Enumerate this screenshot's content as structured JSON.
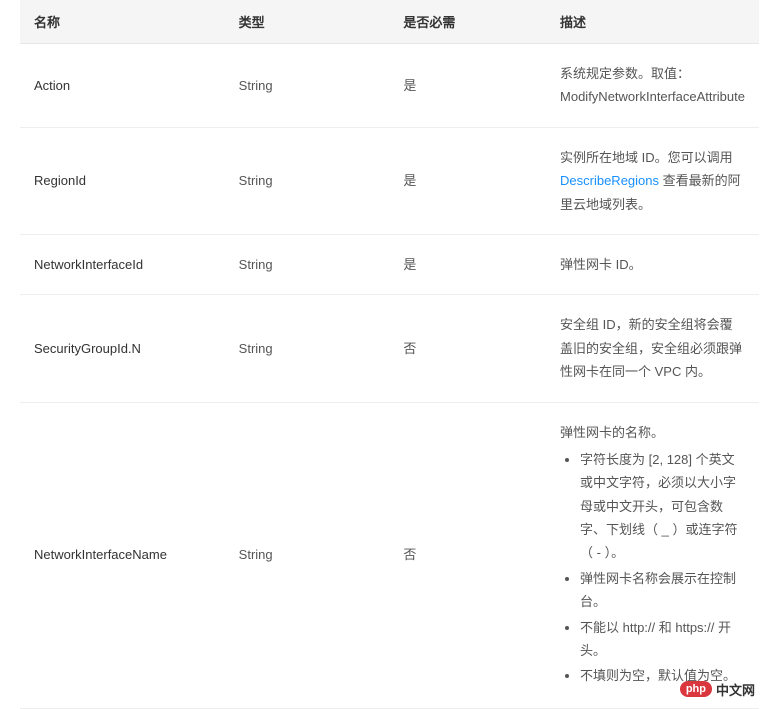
{
  "table": {
    "headers": {
      "name": "名称",
      "type": "类型",
      "required": "是否必需",
      "description": "描述"
    },
    "rows": [
      {
        "name": "Action",
        "type": "String",
        "required": "是",
        "description": {
          "text": "系统规定参数。取值：ModifyNetworkInterfaceAttribute"
        }
      },
      {
        "name": "RegionId",
        "type": "String",
        "required": "是",
        "description": {
          "pre": "实例所在地域 ID。您可以调用 ",
          "link": "DescribeRegions",
          "post": " 查看最新的阿里云地域列表。"
        }
      },
      {
        "name": "NetworkInterfaceId",
        "type": "String",
        "required": "是",
        "description": {
          "text": "弹性网卡 ID。"
        }
      },
      {
        "name": "SecurityGroupId.N",
        "type": "String",
        "required": "否",
        "description": {
          "text": "安全组 ID，新的安全组将会覆盖旧的安全组，安全组必须跟弹性网卡在同一个 VPC 内。"
        }
      },
      {
        "name": "NetworkInterfaceName",
        "type": "String",
        "required": "否",
        "description": {
          "intro": "弹性网卡的名称。",
          "bullets": [
            "字符长度为 [2, 128] 个英文或中文字符，必须以大小字母或中文开头，可包含数字、下划线（ _ ）或连字符（ - ）。",
            "弹性网卡名称会展示在控制台。",
            "不能以 http:// 和 https:// 开头。",
            "不填则为空，默认值为空。"
          ]
        }
      }
    ]
  },
  "watermark": {
    "badge": "php",
    "text": "中文网"
  }
}
